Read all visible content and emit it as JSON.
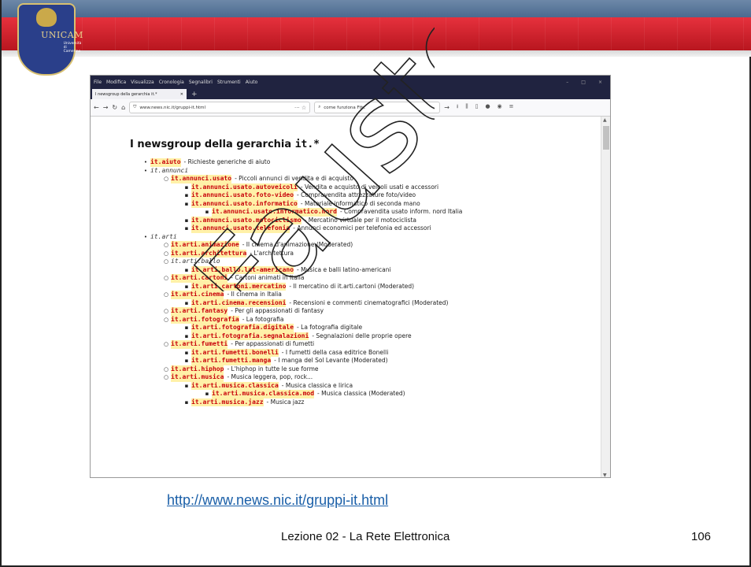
{
  "logo": {
    "name": "UNICAM",
    "sub": "Università di Camerino",
    "year": "1336"
  },
  "browser": {
    "menu": [
      "File",
      "Modifica",
      "Visualizza",
      "Cronologia",
      "Segnalibri",
      "Strumenti",
      "Aiuto"
    ],
    "tab_title": "I newsgroup della gerarchia it.*",
    "url": "www.news.nic.it/gruppi-it.html",
    "search_placeholder": "come funziona Fttc"
  },
  "page": {
    "title_text": "I newsgroup della gerarchia ",
    "title_mono": "it.*",
    "items": [
      {
        "level": 0,
        "bullet": "•",
        "group": "it.aiuto",
        "desc": "Richieste generiche di aiuto",
        "hl": true
      },
      {
        "level": 0,
        "bullet": "•",
        "group": "it.annunci",
        "desc": "",
        "hl": false
      },
      {
        "level": 1,
        "bullet": "○",
        "group": "it.annunci.usato",
        "desc": "Piccoli annunci di vendita e di acquisto",
        "hl": true
      },
      {
        "level": 2,
        "bullet": "▪",
        "group": "it.annunci.usato.autoveicoli",
        "desc": "Vendita e acquisto di veicoli usati e accessori",
        "hl": true
      },
      {
        "level": 2,
        "bullet": "▪",
        "group": "it.annunci.usato.foto-video",
        "desc": "Compravendita attrezzature foto/video",
        "hl": true
      },
      {
        "level": 2,
        "bullet": "▪",
        "group": "it.annunci.usato.informatico",
        "desc": "Materiale informatico di seconda mano",
        "hl": true
      },
      {
        "level": 3,
        "bullet": "▪",
        "group": "it.annunci.usato.informatico.nord",
        "desc": "Compravendita usato inform. nord Italia",
        "hl": true
      },
      {
        "level": 2,
        "bullet": "▪",
        "group": "it.annunci.usato.motociclismo",
        "desc": "Mercatino virtuale per il motociclista",
        "hl": true
      },
      {
        "level": 2,
        "bullet": "▪",
        "group": "it.annunci.usato.telefonia",
        "desc": "Annunci economici per telefonia ed accessori",
        "hl": true
      },
      {
        "level": 0,
        "bullet": "•",
        "group": "it.arti",
        "desc": "",
        "hl": false
      },
      {
        "level": 1,
        "bullet": "○",
        "group": "it.arti.animazione",
        "desc": "Il cinema d'animazione (Moderated)",
        "hl": true
      },
      {
        "level": 1,
        "bullet": "○",
        "group": "it.arti.architettura",
        "desc": "L'architettura",
        "hl": true
      },
      {
        "level": 1,
        "bullet": "○",
        "group": "it.arti.ballo",
        "desc": "",
        "hl": false
      },
      {
        "level": 2,
        "bullet": "▪",
        "group": "it.arti.ballo.lat-americano",
        "desc": "Musica e balli latino-americani",
        "hl": true
      },
      {
        "level": 1,
        "bullet": "○",
        "group": "it.arti.cartoni",
        "desc": "Cartoni animati in Italia",
        "hl": true
      },
      {
        "level": 2,
        "bullet": "▪",
        "group": "it.arti.cartoni.mercatino",
        "desc": "Il mercatino di it.arti.cartoni (Moderated)",
        "hl": true
      },
      {
        "level": 1,
        "bullet": "○",
        "group": "it.arti.cinema",
        "desc": "Il cinema in Italia",
        "hl": true
      },
      {
        "level": 2,
        "bullet": "▪",
        "group": "it.arti.cinema.recensioni",
        "desc": "Recensioni e commenti cinematografici (Moderated)",
        "hl": true
      },
      {
        "level": 1,
        "bullet": "○",
        "group": "it.arti.fantasy",
        "desc": "Per gli appassionati di fantasy",
        "hl": true
      },
      {
        "level": 1,
        "bullet": "○",
        "group": "it.arti.fotografia",
        "desc": "La fotografia",
        "hl": true
      },
      {
        "level": 2,
        "bullet": "▪",
        "group": "it.arti.fotografia.digitale",
        "desc": "La fotografia digitale",
        "hl": true
      },
      {
        "level": 2,
        "bullet": "▪",
        "group": "it.arti.fotografia.segnalazioni",
        "desc": "Segnalazioni delle proprie opere",
        "hl": true
      },
      {
        "level": 1,
        "bullet": "○",
        "group": "it.arti.fumetti",
        "desc": "Per appassionati di fumetti",
        "hl": true
      },
      {
        "level": 2,
        "bullet": "▪",
        "group": "it.arti.fumetti.bonelli",
        "desc": "I fumetti della casa editrice Bonelli",
        "hl": true
      },
      {
        "level": 2,
        "bullet": "▪",
        "group": "it.arti.fumetti.manga",
        "desc": "I manga del Sol Levante (Moderated)",
        "hl": true
      },
      {
        "level": 1,
        "bullet": "○",
        "group": "it.arti.hiphop",
        "desc": "L'hiphop in tutte le sue forme",
        "hl": true
      },
      {
        "level": 1,
        "bullet": "○",
        "group": "it.arti.musica",
        "desc": "Musica leggera, pop, rock...",
        "hl": true
      },
      {
        "level": 2,
        "bullet": "▪",
        "group": "it.arti.musica.classica",
        "desc": "Musica classica e lirica",
        "hl": true
      },
      {
        "level": 3,
        "bullet": "▪",
        "group": "it.arti.musica.classica.mod",
        "desc": "Musica classica (Moderated)",
        "hl": true
      },
      {
        "level": 2,
        "bullet": "▪",
        "group": "it.arti.musica.jazz",
        "desc": "Musica jazz",
        "hl": true
      }
    ]
  },
  "slide": {
    "link": "http://www.news.nic.it/gruppi-it.html",
    "footer": "Lezione 02 - La Rete Elettronica",
    "page_number": "106",
    "watermark": "Fausto"
  },
  "colors": {
    "banner_red": "#d42a33",
    "banner_blue": "#5b7aa0",
    "group_red": "#c8000a",
    "highlight": "#fff1a8",
    "link": "#1a5fa8"
  }
}
